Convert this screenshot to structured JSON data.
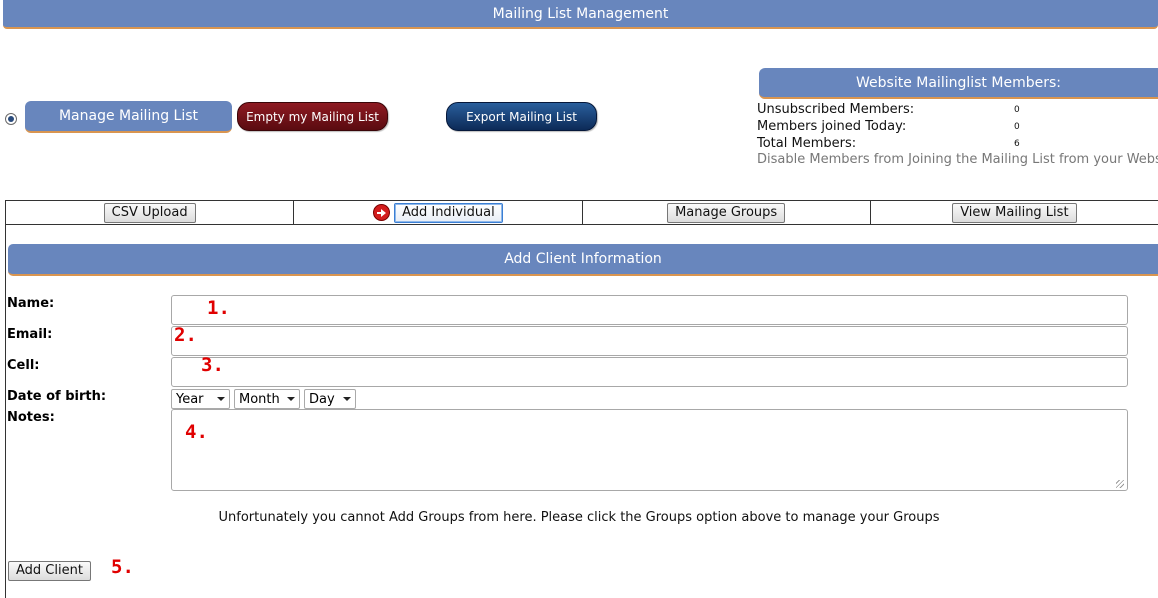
{
  "header": {
    "title": "Mailing List Management"
  },
  "actions": {
    "manage_label": "Manage Mailing List",
    "empty_label": "Empty my Mailing List",
    "export_label": "Export Mailing List"
  },
  "members": {
    "title": "Website Mailinglist Members:",
    "unsubscribed_label": "Unsubscribed Members:",
    "unsubscribed_value": "0",
    "joined_today_label": "Members joined Today:",
    "joined_today_value": "0",
    "total_label": "Total Members:",
    "total_value": "6",
    "disable_link": "Disable Members from Joining the Mailing List from your Website"
  },
  "tabs": {
    "csv_upload": "CSV Upload",
    "add_individual": "Add Individual",
    "manage_groups": "Manage Groups",
    "view_list": "View Mailing List",
    "active": "add_individual"
  },
  "form": {
    "section_title": "Add Client Information",
    "name_label": "Name:",
    "name_value": "",
    "email_label": "Email:",
    "email_value": "",
    "cell_label": "Cell:",
    "cell_value": "",
    "dob_label": "Date of birth:",
    "year_value": "Year",
    "month_value": "Month",
    "day_value": "Day",
    "notes_label": "Notes:",
    "notes_value": "",
    "groups_note": "Unfortunately you cannot Add Groups from here. Please click the Groups option above to manage your Groups",
    "submit_label": "Add Client"
  },
  "annotations": {
    "n1": "1.",
    "n2": "2.",
    "n3": "3.",
    "n4": "4.",
    "n5": "5.",
    "color": "#e00000"
  },
  "colors": {
    "bar_blue": "#6886bd",
    "bar_border": "#d99550",
    "empty_red": "#7a111a",
    "export_navy": "#143a6e"
  }
}
